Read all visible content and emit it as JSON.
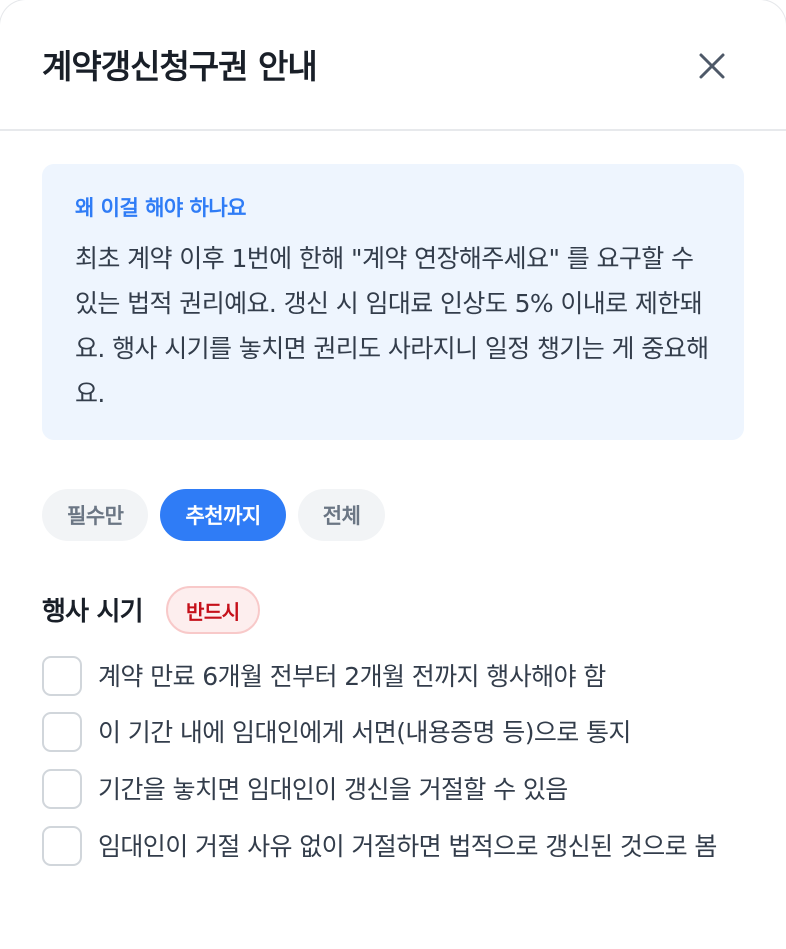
{
  "dialog": {
    "title": "계약갱신청구권 안내",
    "close_icon": "close-icon"
  },
  "info": {
    "label": "왜 이걸 해야 하나요",
    "body": "최초 계약 이후 1번에 한해 \"계약 연장해주세요\" 를 요구할 수 있는 법적 권리예요. 갱신 시 임대료 인상도 5% 이내로 제한돼요. 행사 시기를 놓치면 권리도 사라지니 일정 챙기는 게 중요해요."
  },
  "filters": [
    {
      "label": "필수만",
      "active": false
    },
    {
      "label": "추천까지",
      "active": true
    },
    {
      "label": "전체",
      "active": false
    }
  ],
  "section": {
    "title": "행사 시기",
    "badge": "반드시",
    "items": [
      {
        "text": "계약 만료 6개월 전부터 2개월 전까지 행사해야 함",
        "checked": false
      },
      {
        "text": "이 기간 내에 임대인에게 서면(내용증명 등)으로 통지",
        "checked": false
      },
      {
        "text": "기간을 놓치면 임대인이 갱신을 거절할 수 있음",
        "checked": false
      },
      {
        "text": "임대인이 거절 사유 없이 거절하면 법적으로 갱신된 것으로 봄",
        "checked": false
      }
    ]
  },
  "colors": {
    "accent": "#2f7cf6",
    "info_bg": "#eef5fe",
    "badge_text": "#c5101a",
    "badge_bg": "#fdeeee"
  }
}
